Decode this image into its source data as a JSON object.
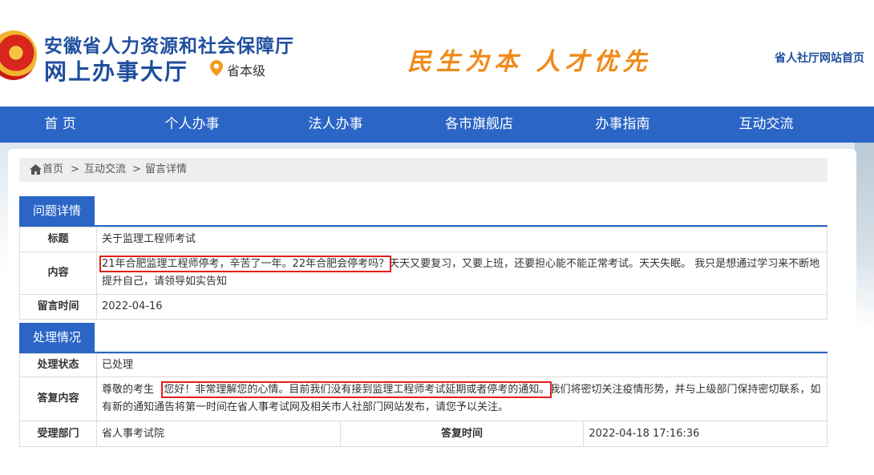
{
  "header": {
    "org_name": "安徽省人力资源和社会保障厅",
    "hall_name": "网上办事大厅",
    "level": "省本级",
    "slogan": "民生为本 人才优先",
    "home_link": "省人社厅网站首页",
    "emblem_icon": "national-emblem-icon",
    "location_icon": "location-pin-icon"
  },
  "nav": {
    "items": [
      "首 页",
      "个人办事",
      "法人办事",
      "各市旗舰店",
      "办事指南",
      "互动交流"
    ]
  },
  "breadcrumb": {
    "home_icon": "home-icon",
    "items": [
      "首页",
      "互动交流",
      "留言详情"
    ],
    "separator": ">"
  },
  "question": {
    "section_title": "问题详情",
    "title_label": "标题",
    "title_value": "关于监理工程师考试",
    "content_label": "内容",
    "content_highlight": "21年合肥监理工程师停考，辛苦了一年。22年合肥会停考吗？",
    "content_rest": "天天又要复习，又要上班，还要担心能不能正常考试。天天失眠。 我只是想通过学习来不断地提升自己，请领导如实告知",
    "time_label": "留言时间",
    "time_value": "2022-04-16"
  },
  "handling": {
    "section_title": "处理情况",
    "status_label": "处理状态",
    "status_value": "已处理",
    "reply_label": "答复内容",
    "reply_prefix": "尊敬的考生",
    "reply_highlight": "您好！非常理解您的心情。目前我们没有接到监理工程师考试延期或者停考的通知。",
    "reply_rest": "我们将密切关注疫情形势，并与上级部门保持密切联系，如有新的通知通告将第一时间在省人事考试网及相关市人社部门网站发布，请您予以关注。",
    "dept_label": "受理部门",
    "dept_value": "省人事考试院",
    "reply_time_label": "答复时间",
    "reply_time_value": "2022-04-18 17:16:36"
  },
  "colors": {
    "brand_blue": "#2b65c6",
    "title_blue": "#1f4e9e",
    "slogan_orange": "#f08a1a",
    "highlight_red": "#e0201b"
  }
}
